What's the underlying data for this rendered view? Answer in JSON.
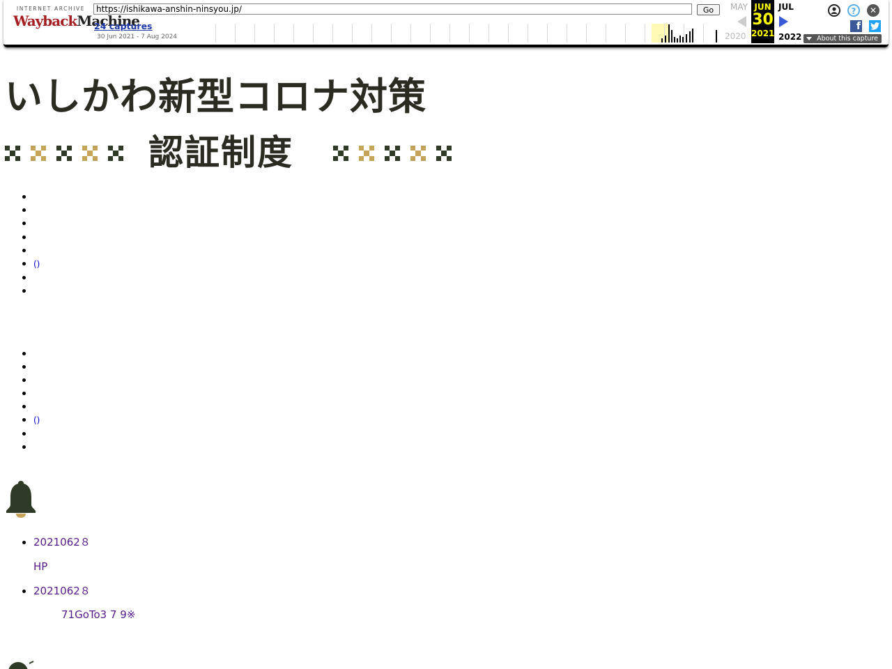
{
  "wayback": {
    "logo_top": "INTERNET ARCHIVE",
    "logo_way": "Wayback",
    "logo_machine": "Machine",
    "url": "https://ishikawa-anshin-ninsyou.jp/",
    "go_label": "Go",
    "captures_label": "24 captures",
    "date_range": "30 Jun 2021 - 7 Aug 2024",
    "prev_month": "MAY",
    "prev_year": "2020",
    "current_month": "JUN",
    "current_day": "30",
    "current_year": "2021",
    "next_month": "JUL",
    "next_year": "2022",
    "about_label": "About this capture",
    "help_glyph": "?",
    "close_glyph": "✕",
    "fb_glyph": "f",
    "colors": {
      "highlight": "#fffab6",
      "current_bg": "#000000",
      "current_fg": "#ffff00",
      "next_arrow": "#3a59d6"
    }
  },
  "page": {
    "skip_link": "",
    "title_line1": "いしかわ新型コロナ対策",
    "title_line2": "認証制度",
    "colors": {
      "dark_green": "#2f3b27",
      "gold": "#c5a45a",
      "title_text": "#2b2b22"
    }
  },
  "nav1": [
    {
      "label": "",
      "sub1": "",
      "sub2": "",
      "small": true
    },
    {
      "label": ""
    },
    {
      "label": "",
      "small": true
    },
    {
      "label": ""
    },
    {
      "label": ""
    },
    {
      "label": "",
      "sub": "()"
    },
    {
      "label": ""
    },
    {
      "label": ""
    }
  ],
  "nav2": [
    {
      "label": ""
    },
    {
      "label": ""
    },
    {
      "label": ""
    },
    {
      "label": ""
    },
    {
      "label": ""
    },
    {
      "label": "",
      "sub": "()"
    },
    {
      "label": ""
    },
    {
      "label": ""
    }
  ],
  "news": {
    "heading": "",
    "items": [
      {
        "date": "2021062８",
        "title": "HP"
      },
      {
        "date": "2021062８",
        "title": "",
        "body": "71GoTo3 7 9※"
      }
    ]
  }
}
